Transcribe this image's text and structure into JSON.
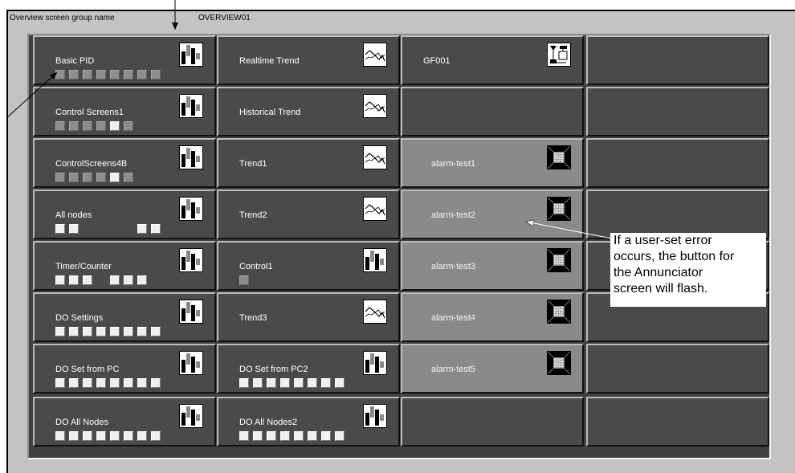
{
  "header": {
    "group_name_label": "Overview screen group name",
    "group_name_value": "OVERVIEW01"
  },
  "tiles": [
    {
      "id": "basic-pid",
      "label": "Basic PID",
      "icon": "bar-graph-icon",
      "alarm": false,
      "indicators": [
        "g",
        "g",
        "g",
        "g",
        "g",
        "g",
        "g",
        "g"
      ]
    },
    {
      "id": "realtime-trend",
      "label": "Realtime Trend",
      "icon": "trend-graph-icon",
      "alarm": false,
      "indicators": []
    },
    {
      "id": "gf001",
      "label": "GF001",
      "icon": "graphic-screen-icon",
      "alarm": false,
      "indicators": []
    },
    {
      "id": "empty-1-4",
      "label": "",
      "icon": "",
      "alarm": false,
      "indicators": []
    },
    {
      "id": "control-screens1",
      "label": "Control Screens1",
      "icon": "bar-graph-icon",
      "alarm": false,
      "indicators": [
        "g",
        "g",
        "g",
        "g",
        "w",
        "g"
      ]
    },
    {
      "id": "historical-trend",
      "label": "Historical Trend",
      "icon": "trend-graph-icon",
      "alarm": false,
      "indicators": []
    },
    {
      "id": "empty-2-3",
      "label": "",
      "icon": "",
      "alarm": false,
      "indicators": []
    },
    {
      "id": "empty-2-4",
      "label": "",
      "icon": "",
      "alarm": false,
      "indicators": []
    },
    {
      "id": "controlscreens4b",
      "label": "ControlScreens4B",
      "icon": "bar-graph-icon",
      "alarm": false,
      "indicators": [
        "g",
        "g",
        "g",
        "g",
        "w",
        "g"
      ]
    },
    {
      "id": "trend1",
      "label": "Trend1",
      "icon": "trend-graph-icon",
      "alarm": false,
      "indicators": []
    },
    {
      "id": "alarm-test1",
      "label": "alarm-test1",
      "icon": "annunciator-icon",
      "alarm": true,
      "indicators": []
    },
    {
      "id": "empty-3-4",
      "label": "",
      "icon": "",
      "alarm": false,
      "indicators": []
    },
    {
      "id": "all-nodes",
      "label": "All nodes",
      "icon": "bar-graph-icon",
      "alarm": false,
      "indicators": [
        "w",
        "w",
        "",
        "",
        "",
        "",
        "w",
        "w"
      ]
    },
    {
      "id": "trend2",
      "label": "Trend2",
      "icon": "trend-graph-icon",
      "alarm": false,
      "indicators": []
    },
    {
      "id": "alarm-test2",
      "label": "alarm-test2",
      "icon": "annunciator-icon",
      "alarm": true,
      "indicators": []
    },
    {
      "id": "empty-4-4",
      "label": "",
      "icon": "",
      "alarm": false,
      "indicators": []
    },
    {
      "id": "timer-counter",
      "label": "Timer/Counter",
      "icon": "bar-graph-icon",
      "alarm": false,
      "indicators": [
        "w",
        "w",
        "w",
        "",
        "w",
        "w",
        "w"
      ]
    },
    {
      "id": "control1",
      "label": "Control1",
      "icon": "bar-graph-icon",
      "alarm": false,
      "indicators": [
        "g"
      ]
    },
    {
      "id": "alarm-test3",
      "label": "alarm-test3",
      "icon": "annunciator-icon",
      "alarm": true,
      "indicators": []
    },
    {
      "id": "empty-5-4",
      "label": "",
      "icon": "",
      "alarm": false,
      "indicators": []
    },
    {
      "id": "do-settings",
      "label": "DO Settings",
      "icon": "bar-graph-icon",
      "alarm": false,
      "indicators": [
        "w",
        "w",
        "w",
        "w",
        "w",
        "w",
        "w",
        "w"
      ]
    },
    {
      "id": "trend3",
      "label": "Trend3",
      "icon": "trend-graph-icon",
      "alarm": false,
      "indicators": []
    },
    {
      "id": "alarm-test4",
      "label": "alarm-test4",
      "icon": "annunciator-icon",
      "alarm": true,
      "indicators": []
    },
    {
      "id": "empty-6-4",
      "label": "",
      "icon": "",
      "alarm": false,
      "indicators": []
    },
    {
      "id": "do-set-from-pc",
      "label": "DO Set from PC",
      "icon": "bar-graph-icon",
      "alarm": false,
      "indicators": [
        "w",
        "w",
        "w",
        "w",
        "w",
        "w",
        "w",
        "w"
      ]
    },
    {
      "id": "do-set-from-pc2",
      "label": "DO Set from PC2",
      "icon": "bar-graph-icon",
      "alarm": false,
      "indicators": [
        "w",
        "w",
        "w",
        "w",
        "w",
        "w",
        "w",
        "w"
      ]
    },
    {
      "id": "alarm-test5",
      "label": "alarm-test5",
      "icon": "annunciator-icon",
      "alarm": true,
      "indicators": []
    },
    {
      "id": "empty-7-4",
      "label": "",
      "icon": "",
      "alarm": false,
      "indicators": []
    },
    {
      "id": "do-all-nodes",
      "label": "DO  All Nodes",
      "icon": "bar-graph-icon",
      "alarm": false,
      "indicators": [
        "w",
        "w",
        "w",
        "w",
        "w",
        "w",
        "w",
        "w"
      ]
    },
    {
      "id": "do-all-nodes2",
      "label": "DO All Nodes2",
      "icon": "bar-graph-icon",
      "alarm": false,
      "indicators": [
        "w",
        "w",
        "w",
        "w",
        "w",
        "w",
        "w",
        "w"
      ]
    },
    {
      "id": "empty-8-3",
      "label": "",
      "icon": "",
      "alarm": false,
      "indicators": []
    },
    {
      "id": "empty-8-4",
      "label": "",
      "icon": "",
      "alarm": false,
      "indicators": []
    }
  ],
  "callout": {
    "lines": [
      "If a user-set error",
      "occurs, the button for",
      "the Annunciator",
      "screen will flash."
    ]
  }
}
